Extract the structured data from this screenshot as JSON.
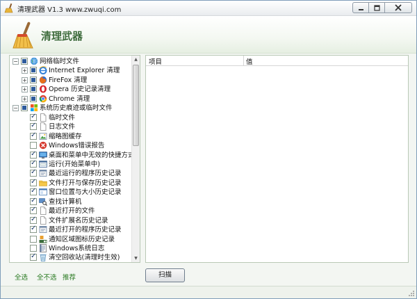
{
  "window": {
    "title": "清理武器 V1.3 www.zwuqi.com"
  },
  "banner": {
    "title": "清理武器"
  },
  "tree": {
    "rows": [
      {
        "label": "网络临时文件",
        "level": 0,
        "expander": "−",
        "check": "mixed",
        "icon": "globe-icon"
      },
      {
        "label": "Internet Explorer 清理",
        "level": 1,
        "expander": "+",
        "check": "mixed",
        "icon": "ie-icon"
      },
      {
        "label": "FireFox 清理",
        "level": 1,
        "expander": "+",
        "check": "mixed",
        "icon": "firefox-icon"
      },
      {
        "label": "Opera 历史记录清理",
        "level": 1,
        "expander": "+",
        "check": "mixed",
        "icon": "opera-icon"
      },
      {
        "label": "Chrome 清理",
        "level": 1,
        "expander": "+",
        "check": "mixed",
        "icon": "chrome-icon"
      },
      {
        "label": "系统历史痕迹或临时文件",
        "level": 0,
        "expander": "−",
        "check": "mixed",
        "icon": "windows-icon"
      },
      {
        "label": "临时文件",
        "level": 1,
        "check": "checked",
        "icon": "file-icon"
      },
      {
        "label": "日志文件",
        "level": 1,
        "check": "checked",
        "icon": "file-icon"
      },
      {
        "label": "缩略图缓存",
        "level": 1,
        "check": "checked",
        "icon": "image-icon"
      },
      {
        "label": "Windows错误报告",
        "level": 1,
        "check": "unchecked",
        "icon": "error-icon"
      },
      {
        "label": "桌面和菜单中无效的快捷方式",
        "level": 1,
        "check": "checked",
        "icon": "desktop-icon"
      },
      {
        "label": "运行(开始菜单中)",
        "level": 1,
        "check": "checked",
        "icon": "run-icon"
      },
      {
        "label": "最近运行的程序历史记录",
        "level": 1,
        "check": "checked",
        "icon": "program-icon"
      },
      {
        "label": "文件打开与保存历史记录",
        "level": 1,
        "check": "checked",
        "icon": "folder-icon"
      },
      {
        "label": "窗口位置与大小历史记录",
        "level": 1,
        "check": "checked",
        "icon": "window-icon"
      },
      {
        "label": "查找计算机",
        "level": 1,
        "check": "checked",
        "icon": "search-computer-icon"
      },
      {
        "label": "最近打开的文件",
        "level": 1,
        "check": "checked",
        "icon": "file-icon"
      },
      {
        "label": "文件扩展名历史记录",
        "level": 1,
        "check": "checked",
        "icon": "file-icon"
      },
      {
        "label": "最近打开的程序历史记录",
        "level": 1,
        "check": "checked",
        "icon": "program-icon"
      },
      {
        "label": "通知区域图标历史记录",
        "level": 1,
        "check": "unchecked",
        "icon": "tray-icon"
      },
      {
        "label": "Windows系统日志",
        "level": 1,
        "check": "unchecked",
        "icon": "log-icon"
      },
      {
        "label": "清空回收站(清理时生效)",
        "level": 1,
        "check": "checked",
        "icon": "recycle-bin-icon"
      }
    ]
  },
  "list": {
    "col_item": "项目",
    "col_value": "值"
  },
  "footer": {
    "select_all": "全选",
    "select_none": "全不选",
    "recommend": "推荐",
    "scan": "扫描"
  },
  "colors": {
    "accent_green": "#2a7a22",
    "banner_title": "#3d6b3b",
    "panel_border": "#b9c8b6"
  }
}
